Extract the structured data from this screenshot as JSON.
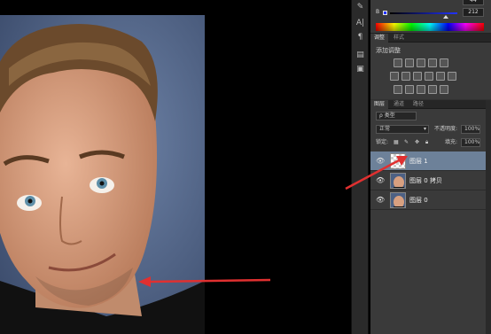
{
  "toolbar": {
    "tools": [
      {
        "name": "brush-tool-icon",
        "glyph": "✎"
      },
      {
        "name": "text-tool-icon",
        "glyph": "A|"
      },
      {
        "name": "paragraph-tool-icon",
        "glyph": "¶"
      },
      {
        "name": "notes-tool-icon",
        "glyph": "▤"
      },
      {
        "name": "history-tool-icon",
        "glyph": "▣"
      }
    ]
  },
  "color_panel": {
    "top_value": "44",
    "b_label": "B",
    "b_value": "212",
    "b_level": 0.83,
    "colors": {
      "fg": "#2233ff",
      "spectrum_start": "#ff0000"
    }
  },
  "adjustments": {
    "tabs": [
      "调整",
      "样式"
    ],
    "title": "添加调整"
  },
  "layers": {
    "tabs": [
      "图层",
      "通道",
      "路径"
    ],
    "filter_placeholder": "ρ 类型",
    "blend_mode": "正常",
    "opacity_label": "不透明度:",
    "opacity_value": "100%",
    "lock_label": "锁定:",
    "fill_label": "填充:",
    "fill_value": "100%",
    "items": [
      {
        "name": "图层 1",
        "selected": true,
        "thumb": "transparent"
      },
      {
        "name": "图层 0 拷贝",
        "selected": false,
        "thumb": "face"
      },
      {
        "name": "图层 0",
        "selected": false,
        "thumb": "face"
      }
    ]
  },
  "colors": {
    "arrow": "#e03030",
    "selected_layer": "#6d8199",
    "panel_bg": "#3a3a3a"
  }
}
